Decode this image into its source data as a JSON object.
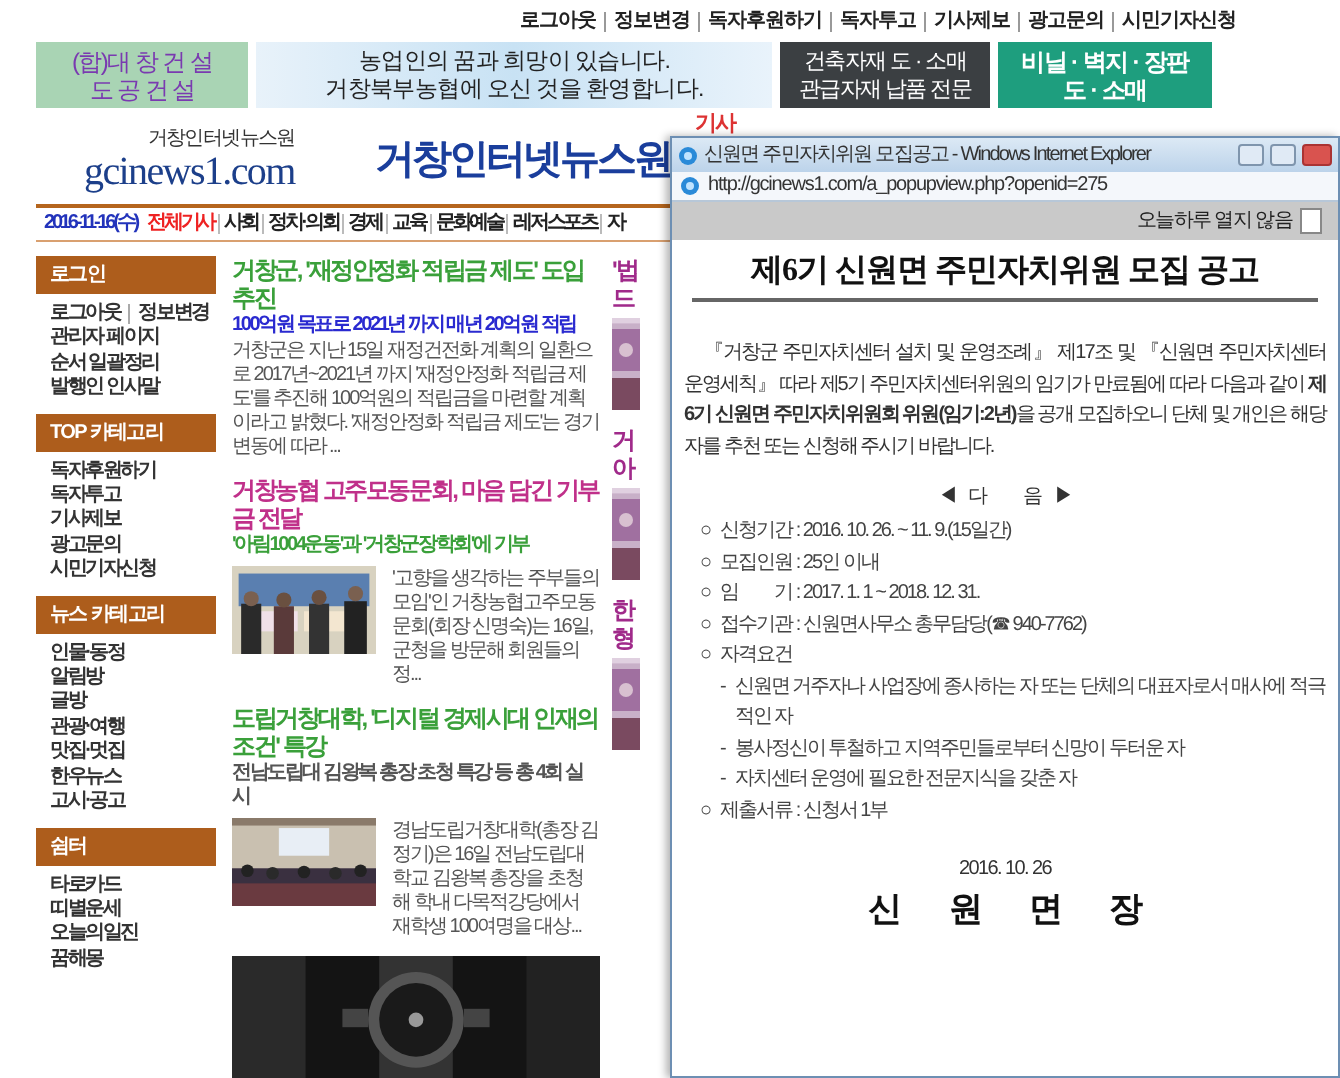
{
  "top_links": [
    "로그아웃",
    "정보변경",
    "독자후원하기",
    "독자투고",
    "기사제보",
    "광고문의",
    "시민기자신청"
  ],
  "banners": [
    {
      "kind": "builder",
      "lines": [
        "(합)대 창 건 설",
        "도 공 건 설"
      ]
    },
    {
      "kind": "sky",
      "lines": [
        "농업인의 꿈과 희망이 있습니다.",
        "거창북부농협에 오신 것을 환영합니다."
      ]
    },
    {
      "kind": "dark",
      "lines": [
        "건축자재 도 · 소매",
        "관급자재 납품 전문"
      ]
    },
    {
      "kind": "teal",
      "lines": [
        "비닐 · 벽지 · 장판",
        "도 · 소매"
      ]
    }
  ],
  "logo": {
    "tagline": "거창인터넷뉴스원",
    "domain": "gcinews1.com"
  },
  "site_title": "거창인터넷뉴스원",
  "search": {
    "label": "기사"
  },
  "menu": {
    "date": "2016-11-16(수)",
    "items": [
      {
        "label": "전체기사",
        "selected": true
      },
      {
        "label": "사회",
        "selected": false
      },
      {
        "label": "정치·의회",
        "selected": false
      },
      {
        "label": "경제",
        "selected": false
      },
      {
        "label": "교육",
        "selected": false
      },
      {
        "label": "문화예술",
        "selected": false
      },
      {
        "label": "레저스포츠",
        "selected": false
      },
      {
        "label": "자",
        "selected": false
      }
    ]
  },
  "sidebar": [
    {
      "title": "로그인",
      "rows": [
        {
          "links": [
            "로그아웃",
            "정보변경"
          ]
        },
        {
          "links": [
            "관리자 페이지"
          ]
        },
        {
          "links": [
            "순서 일괄정리"
          ]
        },
        {
          "links": [
            "발행인 인사말"
          ]
        }
      ]
    },
    {
      "title": "TOP 카테고리",
      "rows": [
        {
          "links": [
            "독자후원하기"
          ]
        },
        {
          "links": [
            "독자투고"
          ]
        },
        {
          "links": [
            "기사제보"
          ]
        },
        {
          "links": [
            "광고문의"
          ]
        },
        {
          "links": [
            "시민기자신청"
          ]
        }
      ]
    },
    {
      "title": "뉴스 카테고리",
      "rows": [
        {
          "links": [
            "인물·동정"
          ]
        },
        {
          "links": [
            "알림방"
          ]
        },
        {
          "links": [
            "글방"
          ]
        },
        {
          "links": [
            "관광·여행"
          ]
        },
        {
          "links": [
            "맛집·멋집"
          ]
        },
        {
          "links": [
            "한우뉴스"
          ]
        },
        {
          "links": [
            "고시·공고"
          ]
        }
      ]
    },
    {
      "title": "쉼터",
      "rows": [
        {
          "links": [
            "타로카드"
          ]
        },
        {
          "links": [
            "띠별운세"
          ]
        },
        {
          "links": [
            "오늘의일진"
          ]
        },
        {
          "links": [
            "꿈해몽"
          ]
        }
      ]
    }
  ],
  "articles": [
    {
      "headline": "거창군, '재정안정화 적립금 제도' 도입 추진",
      "color": "#3aa03a",
      "subhead": {
        "text": "100억원 목표로 2021년 까지 매년 20억원 적립",
        "color": "#2a2ad0"
      },
      "body": "거창군은 지난 15일 재정건전화 계획의 일환으로 2017년~2021년 까지 '재정안정화 적립금 제도'를 추진해 100억원의 적립금을 마련할 계획이라고 밝혔다. '재정안정화 적립금 제도'는 경기변동에 따라 ..."
    },
    {
      "headline": "거창농협 고주모동문회, 마음 담긴 기부금 전달",
      "color": "#c0308a",
      "subhead": {
        "text": "'아림1004운동'과 '거창군장학회'에 기부",
        "color": "#3aa03a"
      },
      "picture": {
        "kind": "picture"
      },
      "body": "'고향을 생각하는 주부들의 모임'인 거창농협고주모동문회(회장 신명숙)는 16일, 군청을 방문해 회원들의 정..."
    },
    {
      "headline": "도립거창대학, '디지털 경제시대 인재의 조건' 특강",
      "color": "#3aa03a",
      "subhead": {
        "text": "전남도립대 김왕복 총장 초청 특강 등 총 4회 실시",
        "color": "#555555"
      },
      "picture": {
        "kind": "picture"
      },
      "body": "경남도립거창대학(총장 김정기)은 16일 전남도립대학교 김왕복 총장을 초청해 학내 다목적강당에서 재학생 100여명을 대상..."
    }
  ],
  "ad": {
    "kind": "picture"
  },
  "side_column": [
    {
      "kind": "headline",
      "text": "'법"
    },
    {
      "kind": "headline",
      "text": "드"
    },
    {
      "kind": "picture"
    },
    {
      "kind": "headline",
      "text": "거"
    },
    {
      "kind": "headline",
      "text": "아"
    },
    {
      "kind": "picture"
    },
    {
      "kind": "headline",
      "text": "한"
    },
    {
      "kind": "headline",
      "text": "형"
    },
    {
      "kind": "picture"
    }
  ],
  "popup": {
    "title": "신원면 주민자치위원 모집공고 - Windows Internet Explorer",
    "url": "http://gcinews1.com/a_popupview.php?openid=275",
    "dismiss": {
      "label": "오늘하루 열지 않음",
      "checked": false
    },
    "heading": "제6기 신원면 주민자치위원 모집 공고",
    "intro": "『거창군 주민자치센터 설치 및 운영조례』 제17조 및 『신원면 주민자치센터 운영세칙』 따라 제5기 주민자치센터위원의 임기가 만료됨에 따라 다음과 같이 **제6기 신원면 주민자치위원회 위원(임기:2년)**을 공개 모집하오니 단체 및 개인은 해당자를 추천 또는 신청해 주시기 바랍니다.",
    "section_title": "◀ 다　　음 ▶",
    "items": [
      {
        "kind": "bullet",
        "marker": "○",
        "text": "신청기간 : 2016. 10. 26. ~ 11. 9.(15일간)"
      },
      {
        "kind": "bullet",
        "marker": "○",
        "text": "모집인원 : 25인 이내"
      },
      {
        "kind": "bullet",
        "marker": "○",
        "text": "임　　기 : 2017. 1. 1 ~ 2018. 12. 31."
      },
      {
        "kind": "bullet",
        "marker": "○",
        "text": "접수기관 : 신원면사무소 총무담당(☎ 940-7762)"
      },
      {
        "kind": "bullet",
        "marker": "○",
        "text": "자격요건"
      },
      {
        "kind": "dash",
        "marker": "-",
        "text": "신원면 거주자나 사업장에 종사하는 자 또는 단체의 대표자로서 매사에 적극적인 자"
      },
      {
        "kind": "dash",
        "marker": "-",
        "text": "봉사정신이 투철하고 지역주민들로부터 신망이 두터운 자"
      },
      {
        "kind": "dash",
        "marker": "-",
        "text": "자치센터 운영에 필요한 전문지식을 갖춘 자"
      },
      {
        "kind": "bullet",
        "marker": "○",
        "text": "제출서류 : 신청서 1부"
      }
    ],
    "date": "2016. 10. 26",
    "signer": "신 원 면 장"
  }
}
